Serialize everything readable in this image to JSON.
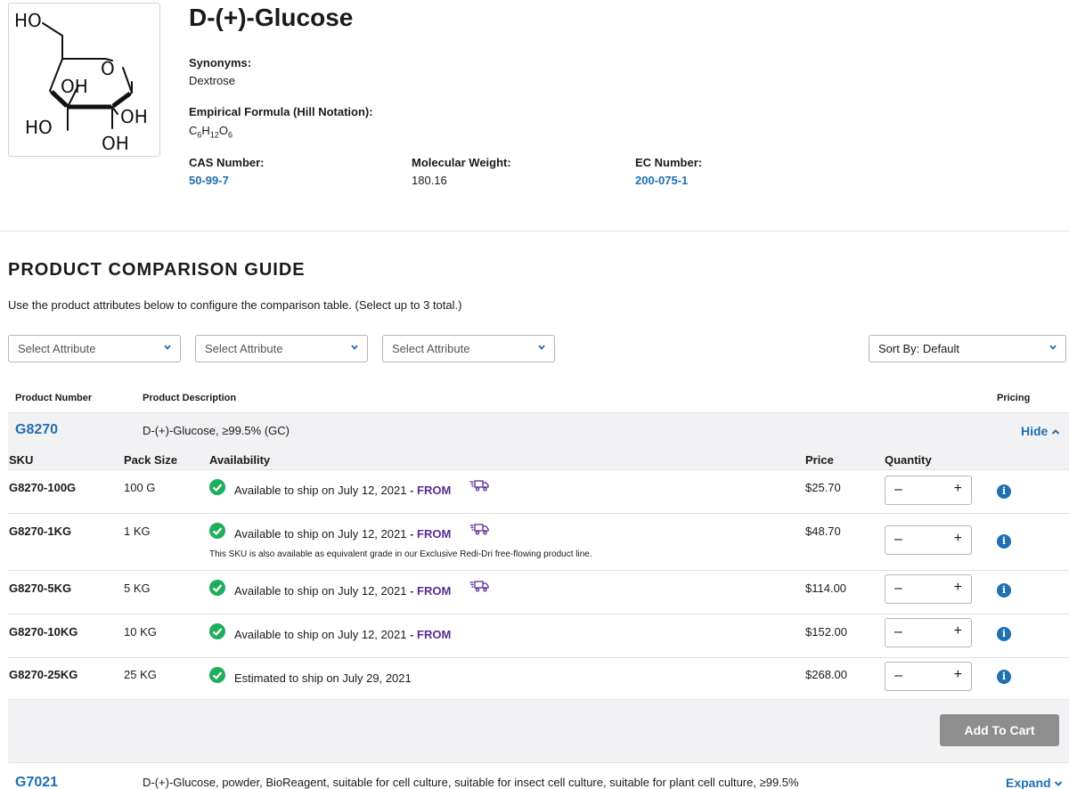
{
  "product": {
    "title": "D-(+)-Glucose",
    "synonyms_label": "Synonyms:",
    "synonyms_value": "Dextrose",
    "formula_label": "Empirical Formula (Hill Notation):",
    "formula_parts": {
      "c": "C",
      "c_n": "6",
      "h": "H",
      "h_n": "12",
      "o": "O",
      "o_n": "6"
    },
    "cas_label": "CAS Number:",
    "cas_value": "50-99-7",
    "mw_label": "Molecular Weight:",
    "mw_value": "180.16",
    "ec_label": "EC Number:",
    "ec_value": "200-075-1",
    "structure_labels": {
      "ho_top": "HO",
      "o_ring": "O",
      "oh_upper": "OH",
      "ho_left": "HO",
      "oh_right": "OH",
      "oh_bottom": "OH"
    }
  },
  "comparison": {
    "title": "PRODUCT COMPARISON GUIDE",
    "help": "Use the product attributes below to configure the comparison table. (Select up to 3 total.)",
    "attribute_selects": [
      "Select Attribute",
      "Select Attribute",
      "Select Attribute"
    ],
    "sort_label": "Sort By: Default"
  },
  "table": {
    "col_product_number": "Product Number",
    "col_product_description": "Product Description",
    "col_pricing": "Pricing",
    "sub_sku": "SKU",
    "sub_pack": "Pack Size",
    "sub_availability": "Availability",
    "sub_price": "Price",
    "sub_quantity": "Quantity"
  },
  "groups": [
    {
      "number": "G8270",
      "description": "D-(+)-Glucose, ≥99.5% (GC)",
      "toggle": "Hide",
      "rows": [
        {
          "sku": "G8270-100G",
          "pack": "100 G",
          "availability": "Available to ship on July 12, 2021",
          "from": "- FROM",
          "price": "$25.70"
        },
        {
          "sku": "G8270-1KG",
          "pack": "1 KG",
          "availability": "Available to ship on July 12, 2021",
          "from": "- FROM",
          "price": "$48.70",
          "note": "This SKU is also available as equivalent grade in our Exclusive Redi-Dri free-flowing product line."
        },
        {
          "sku": "G8270-5KG",
          "pack": "5 KG",
          "availability": "Available to ship on July 12, 2021",
          "from": "- FROM",
          "price": "$114.00"
        },
        {
          "sku": "G8270-10KG",
          "pack": "10 KG",
          "availability": "Available to ship on July 12, 2021",
          "from": "- FROM",
          "price": "$152.00"
        },
        {
          "sku": "G8270-25KG",
          "pack": "25 KG",
          "availability": "Estimated to ship on July 29, 2021",
          "price": "$268.00"
        }
      ],
      "qty_minus": "–",
      "qty_plus": "+",
      "info_glyph": "i",
      "cart_label": "Add To Cart"
    },
    {
      "number": "G7021",
      "description": "D-(+)-Glucose, powder, BioReagent, suitable for cell culture, suitable for insect cell culture, suitable for plant cell culture, ≥99.5%",
      "toggle": "Expand"
    }
  ],
  "colors": {
    "link": "#1f6fb2",
    "from": "#5a2d91",
    "check": "#1fae5b",
    "band": "#f2f2f4",
    "cart": "#8e8e8e"
  },
  "icons": {
    "check": "check-circle-icon",
    "truck": "truck-icon",
    "info": "info-icon",
    "chevron": "chevron-down-icon"
  }
}
